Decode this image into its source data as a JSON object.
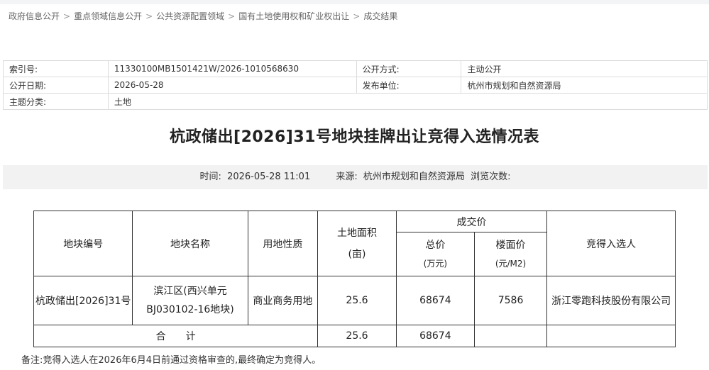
{
  "breadcrumb": [
    "政府信息公开",
    "重点领域信息公开",
    "公共资源配置领域",
    "国有土地使用权和矿业权出让",
    "成交结果"
  ],
  "separator": ">",
  "meta": {
    "index_label": "索引号:",
    "index_value": "11330100MB1501421W/2026-1010568630",
    "open_method_label": "公开方式:",
    "open_method_value": "主动公开",
    "date_label": "公开日期:",
    "date_value": "2026-05-28",
    "publisher_label": "发布单位:",
    "publisher_value": "杭州市规划和自然资源局",
    "category_label": "主题分类:",
    "category_value": "土地"
  },
  "title": "杭政储出[2026]31号地块挂牌出让竞得入选情况表",
  "info": {
    "time_label": "时间:",
    "time_value": "2026-05-28  11:01",
    "source_label": "来源:",
    "source_value": "杭州市规划和自然资源局",
    "views_label": "浏览次数:"
  },
  "table": {
    "h_code": "地块编号",
    "h_name": "地块名称",
    "h_use": "用地性质",
    "h_area": "土地面积",
    "h_area_unit": "(亩)",
    "h_price": "成交价",
    "h_total": "总价",
    "h_total_unit": "(万元)",
    "h_floor": "楼面价",
    "h_floor_unit": "(元/M2)",
    "h_winner": "竞得入选人",
    "row": {
      "code": "杭政储出[2026]31号",
      "name_line1": "滨江区(西兴单元",
      "name_line2": "BJ030102-16地块)",
      "use": "商业商务用地",
      "area": "25.6",
      "total": "68674",
      "floor": "7586",
      "winner": "浙江零跑科技股份有限公司"
    },
    "sum_label": "合　　计",
    "sum_area": "25.6",
    "sum_total": "68674"
  },
  "note": "备注:竞得入选人在2026年6月4日前通过资格审查的,最终确定为竞得人。"
}
